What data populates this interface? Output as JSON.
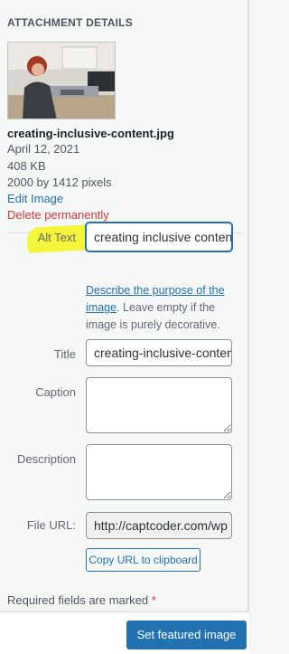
{
  "sidebar": {
    "heading": "ATTACHMENT DETAILS",
    "file": {
      "name": "creating-inclusive-content.jpg",
      "date": "April 12, 2021",
      "size": "408 KB",
      "dimensions": "2000 by 1412 pixels"
    },
    "actions": {
      "edit": "Edit Image",
      "delete": "Delete permanently"
    },
    "fields": {
      "alt_label": "Alt Text",
      "alt_value": "creating inclusive content",
      "alt_help_link": "Describe the purpose of the image",
      "alt_help_rest": ". Leave empty if the image is purely decorative.",
      "title_label": "Title",
      "title_value": "creating-inclusive-content",
      "caption_label": "Caption",
      "caption_value": "",
      "description_label": "Description",
      "description_value": "",
      "url_label": "File URL:",
      "url_value": "http://captcoder.com/wp",
      "copy_button": "Copy URL to clipboard"
    },
    "required_note": "Required fields are marked",
    "required_star": "*"
  },
  "footer": {
    "primary_button": "Set featured image"
  },
  "colors": {
    "link": "#2271b1",
    "danger": "#d63638",
    "highlight": "#f5f53a",
    "primary": "#2271b1"
  }
}
